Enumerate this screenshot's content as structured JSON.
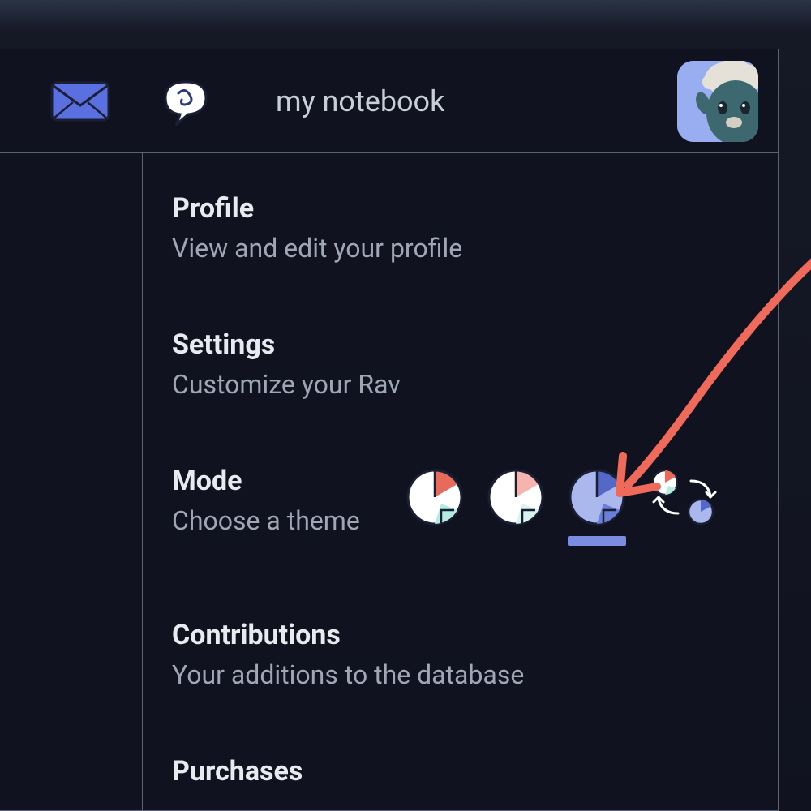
{
  "header": {
    "notebook_label": "my notebook"
  },
  "sections": {
    "profile": {
      "title": "Profile",
      "desc": "View and edit your profile"
    },
    "settings": {
      "title": "Settings",
      "desc": "Customize your Rav"
    },
    "mode": {
      "title": "Mode",
      "desc": "Choose a theme"
    },
    "contributions": {
      "title": "Contributions",
      "desc": "Your additions to the database"
    },
    "purchases": {
      "title": "Purchases"
    }
  },
  "themes": {
    "options": [
      "light",
      "pastel",
      "dark",
      "auto"
    ],
    "selected": "dark"
  }
}
